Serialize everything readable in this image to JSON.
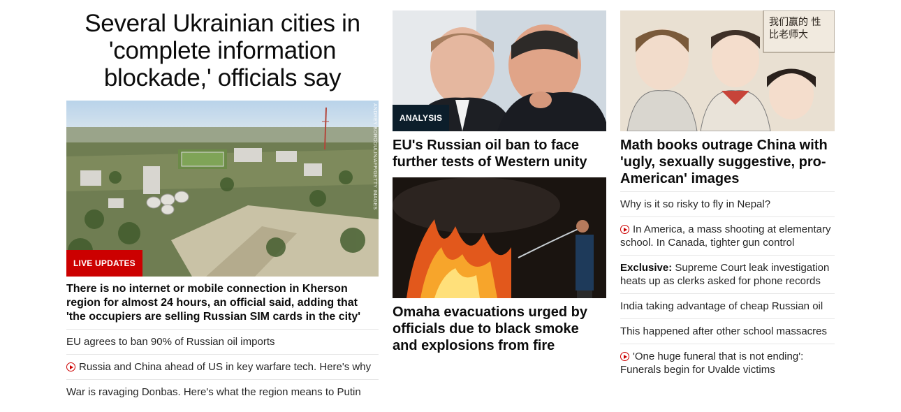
{
  "col1": {
    "headline": "Several Ukrainian cities in 'complete information blockade,' officials say",
    "photo_credit": "ANDREY BORODULIN/AFP/GETTY IMAGES",
    "badge": "LIVE UPDATES",
    "lede": "There is no internet or mobile connection in Kherson region for almost 24 hours, an official said, adding that 'the occupiers are selling Russian SIM cards in the city'",
    "links": [
      {
        "text": "EU agrees to ban 90% of Russian oil imports",
        "video": false
      },
      {
        "text": "Russia and China ahead of US in key warfare tech. Here's why",
        "video": true
      },
      {
        "text": "War is ravaging Donbas. Here's what the region means to Putin",
        "video": false
      }
    ]
  },
  "col2": {
    "story1": {
      "badge": "ANALYSIS",
      "title": "EU's Russian oil ban to face further tests of Western unity"
    },
    "story2": {
      "title": "Omaha evacuations urged by officials due to black smoke and explosions from fire"
    }
  },
  "col3": {
    "image_text": "我们赢的 性比老师大",
    "title": "Math books outrage China with 'ugly, sexually suggestive, pro-American' images",
    "links": [
      {
        "prefix": "",
        "text": "Why is it so risky to fly in Nepal?",
        "video": false
      },
      {
        "prefix": "",
        "text": "In America, a mass shooting at elementary school. In Canada, tighter gun control",
        "video": true
      },
      {
        "prefix": "Exclusive:",
        "text": " Supreme Court leak investigation heats up as clerks asked for phone records",
        "video": false
      },
      {
        "prefix": "",
        "text": "India taking advantage of cheap Russian oil",
        "video": false
      },
      {
        "prefix": "",
        "text": "This happened after other school massacres",
        "video": false
      },
      {
        "prefix": "",
        "text": "'One huge funeral that is not ending': Funerals begin for Uvalde victims",
        "video": true
      }
    ]
  },
  "colors": {
    "live_badge": "#cc0000",
    "analysis_badge": "#0c1e2b",
    "play_icon": "#cc0000",
    "divider": "#e6e6e6"
  }
}
